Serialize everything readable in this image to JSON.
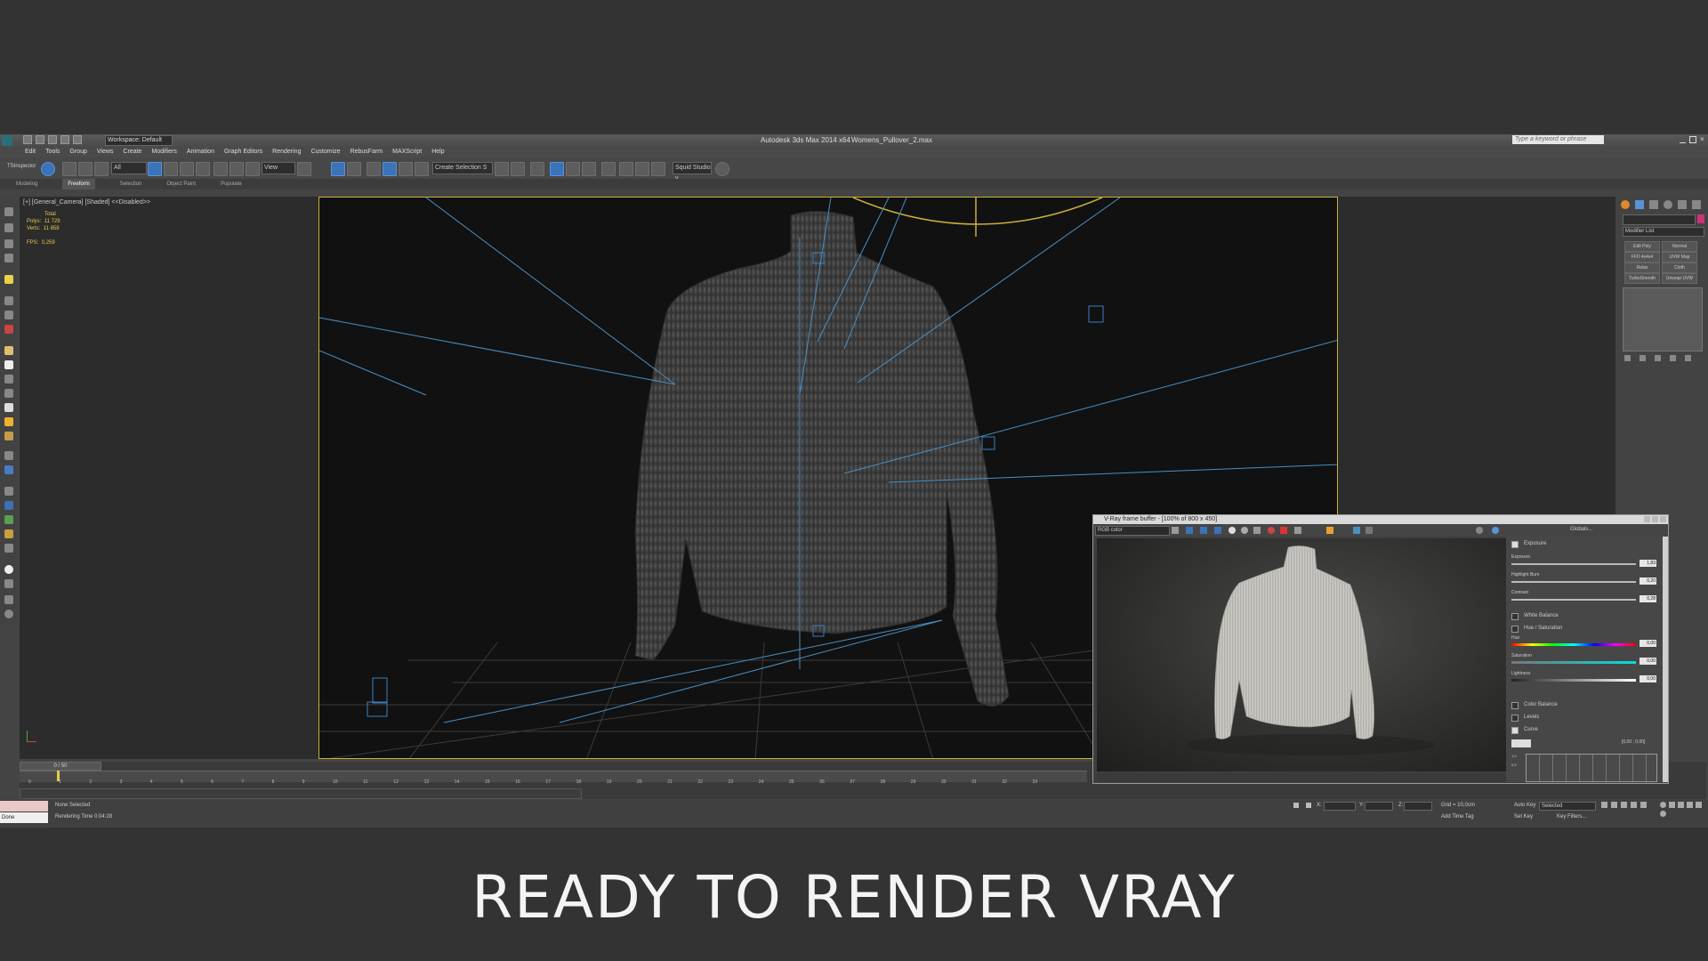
{
  "app": {
    "title": "Autodesk 3ds Max  2014 x64",
    "file": "Womens_Pullover_2.max",
    "workspace": "Workspace: Default",
    "search_placeholder": "Type a keyword or phrase"
  },
  "menu": [
    "Edit",
    "Tools",
    "Group",
    "Views",
    "Create",
    "Modifiers",
    "Animation",
    "Graph Editors",
    "Rendering",
    "Customize",
    "RebusFarm",
    "MAXScript",
    "Help"
  ],
  "toolbar": {
    "tsinspector": "TSInspector",
    "filter": "All",
    "view": "View",
    "selection_set": "Create Selection S",
    "squid": "Squid Studio v"
  },
  "ribbon": [
    "Modeling",
    "Freeform",
    "Selection",
    "Object Paint",
    "Populate"
  ],
  "viewport": {
    "label": "[+] [General_Camera] [Shaded] <<Disabled>>",
    "stats_title": "Total",
    "polys_label": "Polys:",
    "polys": "11 729",
    "verts_label": "Verts:",
    "verts": "11 858",
    "fps_label": "FPS:",
    "fps": "0,259"
  },
  "command_panel": {
    "modifier_list": "Modifier List",
    "buttons": [
      "Edit Poly",
      "Normal",
      "FFD 4x4x4",
      "UVW Map",
      "Relax",
      "Cloth",
      "TurboSmooth",
      "Unwrap UVW"
    ]
  },
  "timeline": {
    "frame_counter": "0 / 50",
    "ticks": [
      "0",
      "1",
      "2",
      "3",
      "4",
      "5",
      "6",
      "7",
      "8",
      "9",
      "10",
      "11",
      "12",
      "13",
      "14",
      "15",
      "16",
      "17",
      "18",
      "19",
      "20",
      "21",
      "22",
      "23",
      "24",
      "25",
      "26",
      "27",
      "28",
      "29",
      "30",
      "31",
      "32",
      "33"
    ]
  },
  "status": {
    "selection": "None Selected",
    "render_time": "Rendering Time  0:04:28",
    "done": "Done",
    "x": "X:",
    "y": "Y:",
    "z": "Z:",
    "grid": "Grid = 10,0cm",
    "add_time_tag": "Add Time Tag",
    "auto_key": "Auto Key",
    "selected": "Selected",
    "set_key": "Set Key",
    "key_filters": "Key Filters..."
  },
  "vfb": {
    "title": "V-Ray frame buffer - [100% of 800 x 450]",
    "channel": "RGB color",
    "globals": "Globals...",
    "exposure_section": "Exposure",
    "exposure_label": "Exposure",
    "exposure": "1,83",
    "highlight_label": "Highlight Burn",
    "highlight": "0,20",
    "contrast_label": "Contrast",
    "contrast": "0,28",
    "white_balance": "White Balance",
    "hue_saturation": "Hue / Saturation",
    "hue_label": "Hue",
    "hue": "0,00",
    "saturation_label": "Saturation",
    "saturation": "0,00",
    "lightness_label": "Lightness",
    "lightness": "0,00",
    "color_balance": "Color Balance",
    "levels": "Levels",
    "curve": "Curve",
    "curve_coords": "[0,00 ; 0,00]",
    "curve_y1": "1,0",
    "curve_y2": "0,9"
  },
  "caption": "READY TO RENDER VRAY",
  "colors": {
    "viewport_border": "#c9b03a",
    "wire": "#4a8fc4",
    "stats": "#e8c84a",
    "accent": "#3b73b9"
  }
}
